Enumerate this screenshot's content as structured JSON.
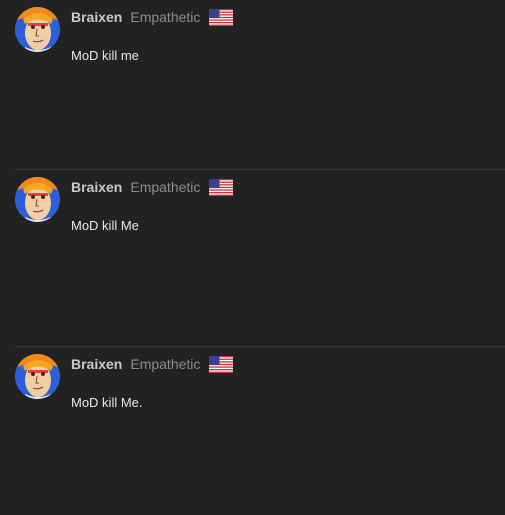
{
  "posts": [
    {
      "username": "Braixen",
      "rank": "Empathetic",
      "flag_icon": "us-flag-icon",
      "message": "MoD kill me"
    },
    {
      "username": "Braixen",
      "rank": "Empathetic",
      "flag_icon": "us-flag-icon",
      "message": "MoD kill Me"
    },
    {
      "username": "Braixen",
      "rank": "Empathetic",
      "flag_icon": "us-flag-icon",
      "message": "MoD kill Me."
    }
  ],
  "colors": {
    "background": "#222222",
    "username": "#c8c8c8",
    "rank": "#8c8c8c",
    "message": "#e6e6e6",
    "divider": "#383838"
  }
}
